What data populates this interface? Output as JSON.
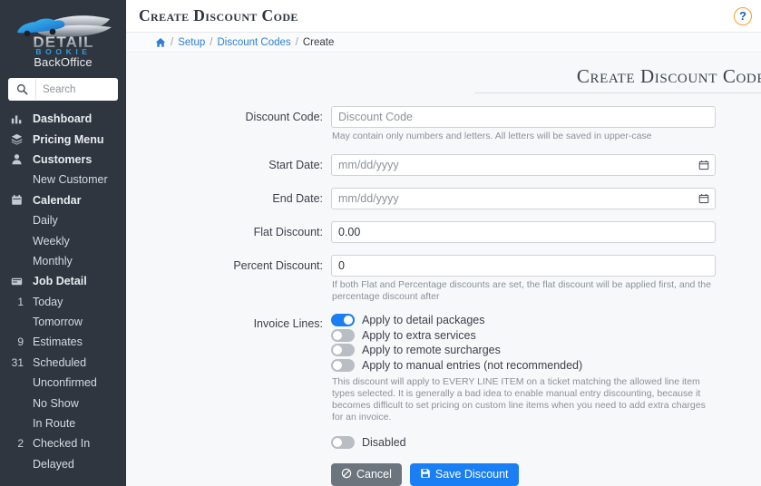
{
  "sidebar": {
    "brand": {
      "logo_main": "DETAIL",
      "logo_sub": "BOOKIE",
      "subtitle": "BackOffice",
      "logo_icon": "car-boat-logo",
      "colors": {
        "accent": "#1f9fe0",
        "silver": "#c9ced4"
      }
    },
    "search": {
      "placeholder": "Search",
      "value": "",
      "icon": "search-icon"
    },
    "items": [
      {
        "label": "Dashboard",
        "icon": "bar-chart-icon",
        "top": true,
        "badge": ""
      },
      {
        "label": "Pricing Menu",
        "icon": "layers-icon",
        "top": true,
        "badge": ""
      },
      {
        "label": "Customers",
        "icon": "user-icon",
        "top": true,
        "badge": ""
      },
      {
        "label": "New Customer",
        "icon": "",
        "top": false,
        "badge": ""
      },
      {
        "label": "Calendar",
        "icon": "calendar-icon",
        "top": true,
        "badge": ""
      },
      {
        "label": "Daily",
        "icon": "",
        "top": false,
        "badge": ""
      },
      {
        "label": "Weekly",
        "icon": "",
        "top": false,
        "badge": ""
      },
      {
        "label": "Monthly",
        "icon": "",
        "top": false,
        "badge": ""
      },
      {
        "label": "Job Detail",
        "icon": "window-icon",
        "top": true,
        "badge": ""
      },
      {
        "label": "Today",
        "icon": "",
        "top": false,
        "badge": "1"
      },
      {
        "label": "Tomorrow",
        "icon": "",
        "top": false,
        "badge": ""
      },
      {
        "label": "Estimates",
        "icon": "",
        "top": false,
        "badge": "9"
      },
      {
        "label": "Scheduled",
        "icon": "",
        "top": false,
        "badge": "31"
      },
      {
        "label": "Unconfirmed",
        "icon": "",
        "top": false,
        "badge": ""
      },
      {
        "label": "No Show",
        "icon": "",
        "top": false,
        "badge": ""
      },
      {
        "label": "In Route",
        "icon": "",
        "top": false,
        "badge": ""
      },
      {
        "label": "Checked In",
        "icon": "",
        "top": false,
        "badge": "2"
      },
      {
        "label": "Delayed",
        "icon": "",
        "top": false,
        "badge": ""
      }
    ]
  },
  "topbar": {
    "title": "Create Discount Code",
    "help_icon": "question-circle-icon"
  },
  "breadcrumb": {
    "home_icon": "home-icon",
    "separator": "/",
    "items": [
      {
        "label": "Setup",
        "current": false
      },
      {
        "label": "Discount Codes",
        "current": false
      },
      {
        "label": "Create",
        "current": true
      }
    ]
  },
  "form": {
    "heading": "Create Discount Code",
    "discount_code": {
      "label": "Discount Code:",
      "placeholder": "Discount Code",
      "value": "",
      "hint": "May contain only numbers and letters. All letters will be saved in upper-case"
    },
    "start_date": {
      "label": "Start Date:",
      "placeholder": "mm/dd/yyyy",
      "value": "",
      "icon": "calendar-picker-icon"
    },
    "end_date": {
      "label": "End Date:",
      "placeholder": "mm/dd/yyyy",
      "value": "",
      "icon": "calendar-picker-icon"
    },
    "flat_discount": {
      "label": "Flat Discount:",
      "value": "0.00"
    },
    "percent_discount": {
      "label": "Percent Discount:",
      "value": "0",
      "hint": "If both Flat and Percentage discounts are set, the flat discount will be applied first, and the percentage discount after"
    },
    "invoice_lines": {
      "label": "Invoice Lines:",
      "options": [
        {
          "label": "Apply to detail packages",
          "on": true
        },
        {
          "label": "Apply to extra services",
          "on": false
        },
        {
          "label": "Apply to remote surcharges",
          "on": false
        },
        {
          "label": "Apply to manual entries (not recommended)",
          "on": false
        }
      ],
      "hint": "This discount will apply to EVERY LINE ITEM on a ticket matching the allowed line item types selected. It is generally a bad idea to enable manual entry discounting, because it becomes difficult to set pricing on custom line items when you need to add extra charges for an invoice."
    },
    "disabled_toggle": {
      "label": "Disabled",
      "on": false
    },
    "buttons": {
      "cancel": {
        "label": "Cancel",
        "icon": "ban-icon",
        "color": "#6c757d"
      },
      "save": {
        "label": "Save Discount",
        "icon": "floppy-disk-icon",
        "color": "#1a7ef5"
      }
    }
  }
}
